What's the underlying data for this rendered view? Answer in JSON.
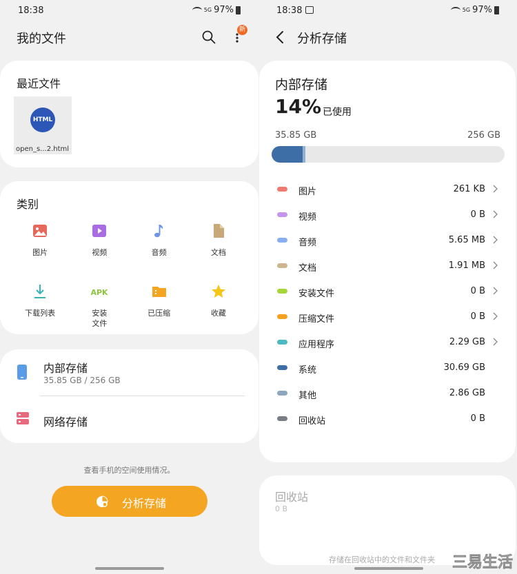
{
  "left": {
    "status": {
      "time": "18:38",
      "network": "5G",
      "battery": "97%"
    },
    "header": {
      "title": "我的文件",
      "badge": "新"
    },
    "recent": {
      "title": "最近文件",
      "file_icon_text": "HTML",
      "file_name": "open_s...2.html"
    },
    "categories": {
      "title": "类别",
      "items": [
        {
          "label": "图片",
          "icon": "image-icon",
          "color": "#e8675b"
        },
        {
          "label": "视频",
          "icon": "video-icon",
          "color": "#a86de0"
        },
        {
          "label": "音频",
          "icon": "audio-icon",
          "color": "#6f95e6"
        },
        {
          "label": "文档",
          "icon": "document-icon",
          "color": "#c9a878"
        },
        {
          "label": "下载列表",
          "icon": "download-icon",
          "color": "#33b2b7"
        },
        {
          "label": "安装文件",
          "icon": "apk-icon",
          "color": "#8cc63e"
        },
        {
          "label": "已压缩",
          "icon": "zip-icon",
          "color": "#f4a623"
        },
        {
          "label": "收藏",
          "icon": "star-icon",
          "color": "#f5c518"
        }
      ]
    },
    "storage": {
      "internal_name": "内部存储",
      "internal_usage": "35.85 GB / 256 GB",
      "network_name": "网络存储"
    },
    "hint": "查看手机的空间使用情况。",
    "analyze_button": "分析存储"
  },
  "right": {
    "status": {
      "time": "18:38",
      "network": "5G",
      "battery": "97%"
    },
    "header": {
      "title": "分析存储"
    },
    "internal": {
      "title": "内部存储",
      "percent": "14%",
      "percent_label": "已使用",
      "used": "35.85 GB",
      "total": "256 GB",
      "used_fraction": 0.14
    },
    "categories": [
      {
        "name": "图片",
        "size": "261 KB",
        "color": "#ee7a70",
        "chevron": true
      },
      {
        "name": "视频",
        "size": "0 B",
        "color": "#c594ec",
        "chevron": true
      },
      {
        "name": "音频",
        "size": "5.65 MB",
        "color": "#88aef0",
        "chevron": true
      },
      {
        "name": "文档",
        "size": "1.91 MB",
        "color": "#cfb490",
        "chevron": true
      },
      {
        "name": "安装文件",
        "size": "0 B",
        "color": "#a6d53c",
        "chevron": true
      },
      {
        "name": "压缩文件",
        "size": "0 B",
        "color": "#f4a21e",
        "chevron": true
      },
      {
        "name": "应用程序",
        "size": "2.29 GB",
        "color": "#4db9c1",
        "chevron": true
      },
      {
        "name": "系统",
        "size": "30.69 GB",
        "color": "#3d6ea6",
        "chevron": false
      },
      {
        "name": "其他",
        "size": "2.86 GB",
        "color": "#8ba6bd",
        "chevron": false
      },
      {
        "name": "回收站",
        "size": "0 B",
        "color": "#7a7d85",
        "chevron": false
      }
    ],
    "trash": {
      "title": "回收站",
      "size": "0 B",
      "note": "存储在回收站中的文件和文件夹"
    },
    "watermark": "三易生活"
  }
}
